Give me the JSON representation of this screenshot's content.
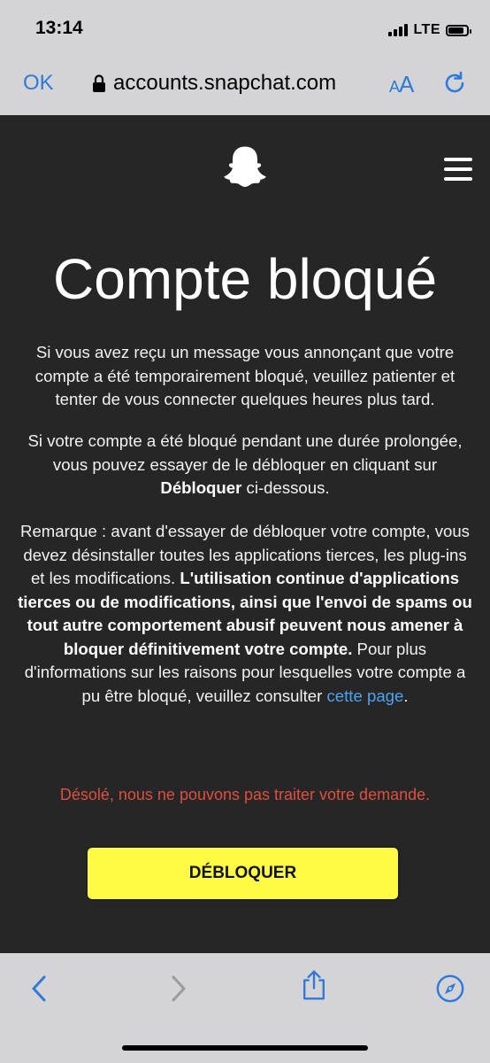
{
  "status_bar": {
    "time": "13:14",
    "network": "LTE",
    "battery_level": 0.85
  },
  "browser": {
    "ok_label": "OK",
    "url": "accounts.snapchat.com",
    "aa_large": "A",
    "aa_small": "A"
  },
  "page": {
    "title": "Compte bloqué",
    "p1": "Si vous avez reçu un message vous annonçant que votre compte a été temporairement bloqué, veuillez patienter et tenter de vous connecter quelques heures plus tard.",
    "p2_before": "Si votre compte a été bloqué pendant une durée prolongée, vous pouvez essayer de le débloquer en cliquant sur ",
    "p2_bold": "Débloquer",
    "p2_after": " ci-dessous.",
    "p3_before": "Remarque : avant d'essayer de débloquer votre compte, vous devez désinstaller toutes les applications tierces, les plug-ins et les modifications. ",
    "p3_bold": "L'utilisation continue d'applications tierces ou de modifications, ainsi que l'envoi de spams ou tout autre comportement abusif peuvent nous amener à bloquer définitivement votre compte.",
    "p3_after": " Pour plus d'informations sur les raisons pour lesquelles votre compte a pu être bloqué, veuillez consulter ",
    "p3_link": "cette page",
    "p3_end": ".",
    "error": "Désolé, nous ne pouvons pas traiter votre demande.",
    "unblock_label": "DÉBLOQUER"
  },
  "icons": {
    "logo": "snapchat-ghost-icon",
    "menu": "hamburger-menu-icon",
    "lock": "lock-icon",
    "reload": "reload-icon",
    "back": "chevron-left-icon",
    "forward": "chevron-right-icon",
    "share": "share-icon",
    "compass": "compass-icon"
  },
  "colors": {
    "accent": "#2f7ad9",
    "button": "#fffc43",
    "error": "#de4f3f",
    "link": "#4ea3ef",
    "background": "#262626"
  }
}
